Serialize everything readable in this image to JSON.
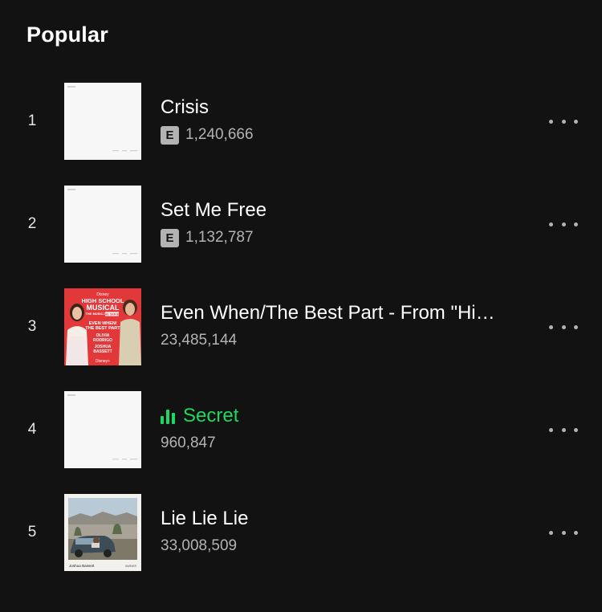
{
  "section": {
    "title": "Popular"
  },
  "tracks": [
    {
      "rank": "1",
      "title": "Crisis",
      "explicit": true,
      "explicit_label": "E",
      "plays": "1,240,666",
      "cover": "white-album",
      "playing": false
    },
    {
      "rank": "2",
      "title": "Set Me Free",
      "explicit": true,
      "explicit_label": "E",
      "plays": "1,132,787",
      "cover": "white-album",
      "playing": false
    },
    {
      "rank": "3",
      "title": "Even When/The Best Part - From \"Hi…",
      "explicit": false,
      "plays": "23,485,144",
      "cover": "hsm-album",
      "playing": false
    },
    {
      "rank": "4",
      "title": "Secret",
      "explicit": false,
      "plays": "960,847",
      "cover": "white-album",
      "playing": true
    },
    {
      "rank": "5",
      "title": "Lie Lie Lie",
      "explicit": false,
      "plays": "33,008,509",
      "cover": "car-photo-album",
      "playing": false
    }
  ],
  "hsm_cover": {
    "brand": "Disney",
    "line1": "HIGH SCHOOL",
    "line2": "MUSICAL",
    "line3": "THE MUSICAL",
    "line4": "THE SERIES",
    "song1": "EVEN WHEN/",
    "song2": "THE BEST PART",
    "artist1": "OLIVIA",
    "artist2": "RODRIGO",
    "artist3": "JOSHUA",
    "artist4": "BASSETT",
    "footer": "Disney+"
  },
  "car_cover": {
    "artist": "Joshua Bassett",
    "label": "WARNER"
  },
  "colors": {
    "background": "#121212",
    "playing_green": "#1ed760",
    "secondary_text": "#b3b3b3",
    "hsm_red": "#e2383a"
  }
}
